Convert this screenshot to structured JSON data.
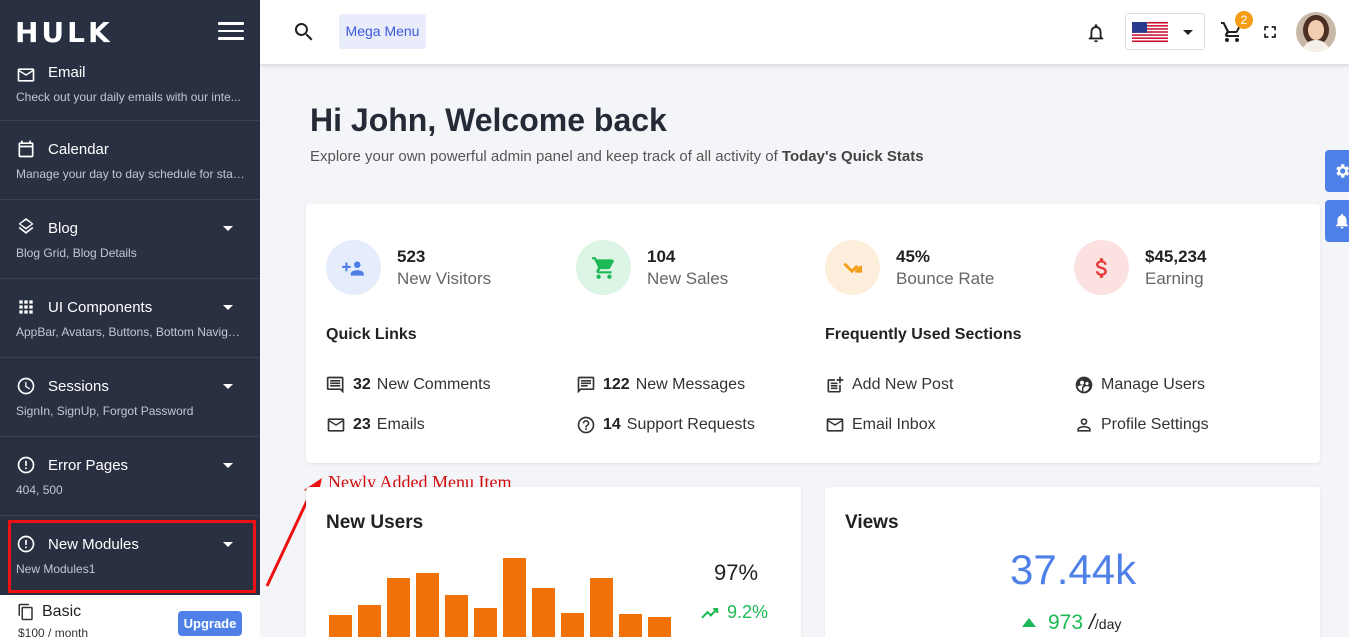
{
  "brand": {
    "logo": "HULK"
  },
  "sidebar": {
    "items": [
      {
        "title": "Email",
        "sub": "Check out your daily emails with our inte...",
        "icon": "mail-icon"
      },
      {
        "title": "Calendar",
        "sub": "Manage your day to day schedule for staf...",
        "icon": "calendar-icon"
      },
      {
        "title": "Blog",
        "sub": "Blog Grid, Blog Details",
        "icon": "layers-icon"
      },
      {
        "title": "UI Components",
        "sub": "AppBar, Avatars, Buttons, Bottom Navigat...",
        "icon": "grid-icon"
      },
      {
        "title": "Sessions",
        "sub": "SignIn, SignUp, Forgot Password",
        "icon": "clock-icon"
      },
      {
        "title": "Error Pages",
        "sub": "404, 500",
        "icon": "alert-icon"
      },
      {
        "title": "New Modules",
        "sub": "New Modules1",
        "icon": "alert-icon"
      }
    ],
    "plan": {
      "name": "Basic",
      "price": "$100 / month",
      "upgrade_label": "Upgrade"
    }
  },
  "header": {
    "mega_menu": "Mega Menu",
    "cart_count": "2"
  },
  "welcome": {
    "title": "Hi John, Welcome back",
    "subtitle_prefix": "Explore your own powerful admin panel and keep track of all activity of ",
    "subtitle_bold": "Today's Quick Stats"
  },
  "stats": [
    {
      "value": "523",
      "label": "New Visitors",
      "icon": "people-icon",
      "color": "#4f80e8",
      "bg": "#e5ecfc"
    },
    {
      "value": "104",
      "label": "New Sales",
      "icon": "cart-icon",
      "color": "#1db954",
      "bg": "#dcf5e4"
    },
    {
      "value": "45%",
      "label": "Bounce Rate",
      "icon": "bounce-icon",
      "color": "#f59d17",
      "bg": "#fdeedb"
    },
    {
      "value": "$45,234",
      "label": "Earning",
      "icon": "dollar-icon",
      "color": "#e53935",
      "bg": "#fce1e1"
    }
  ],
  "quick_links": {
    "title": "Quick Links",
    "items": [
      {
        "count": "32",
        "label": "New Comments",
        "icon": "comment-icon"
      },
      {
        "count": "122",
        "label": "New Messages",
        "icon": "message-icon"
      },
      {
        "count": "23",
        "label": "Emails",
        "icon": "mail-icon"
      },
      {
        "count": "14",
        "label": "Support Requests",
        "icon": "help-icon"
      }
    ]
  },
  "frequent": {
    "title": "Frequently Used Sections",
    "items": [
      {
        "label": "Add New Post",
        "icon": "post-add-icon"
      },
      {
        "label": "Manage Users",
        "icon": "manage-users-icon"
      },
      {
        "label": "Email Inbox",
        "icon": "mail-icon"
      },
      {
        "label": "Profile Settings",
        "icon": "person-icon"
      }
    ]
  },
  "annotation": "Newly Added Menu Item",
  "new_users": {
    "title": "New Users",
    "percent": "97%",
    "trend": "9.2%",
    "bar_levels": [
      0.18,
      0.27,
      0.49,
      0.53,
      0.35,
      0.24,
      0.66,
      0.41,
      0.2,
      0.49,
      0.19,
      0.17
    ]
  },
  "views": {
    "title": "Views",
    "value": "37.44k",
    "per_day": "973",
    "unit": "/day"
  }
}
